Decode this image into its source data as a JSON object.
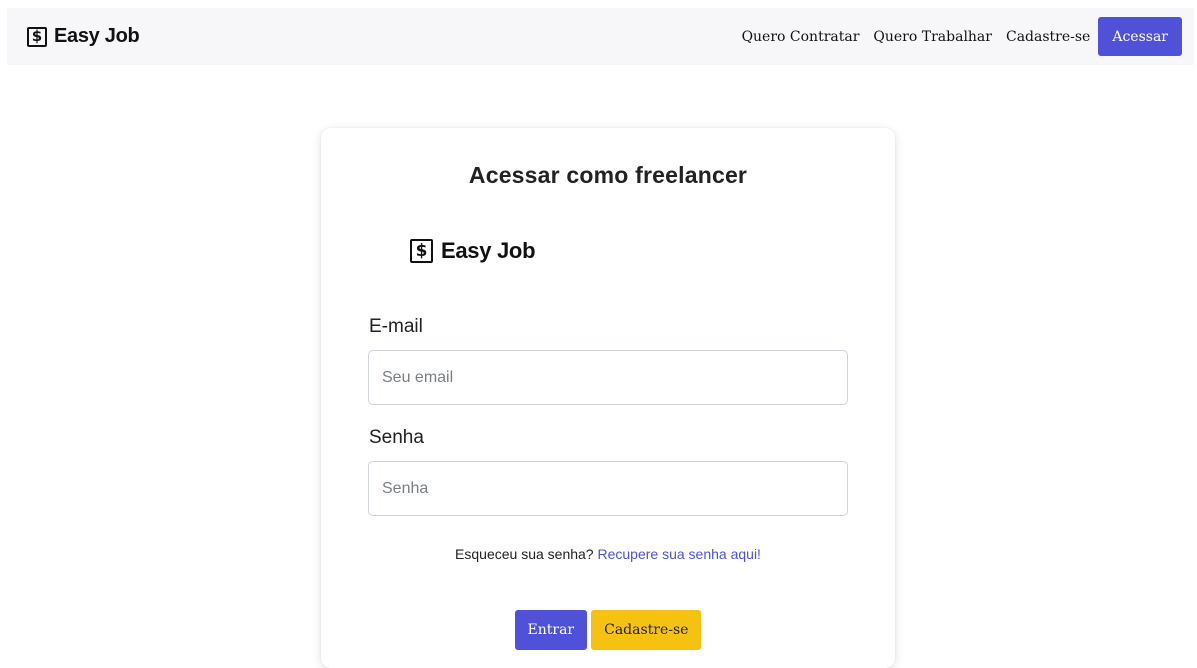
{
  "navbar": {
    "brand_symbol": "$",
    "brand_name": "Easy Job",
    "links": [
      "Quero Contratar",
      "Quero Trabalhar",
      "Cadastre-se"
    ],
    "access_button": "Acessar"
  },
  "card": {
    "title": "Acessar como freelancer",
    "brand_symbol": "$",
    "brand_name": "Easy Job",
    "email": {
      "label": "E-mail",
      "placeholder": "Seu email",
      "value": ""
    },
    "password": {
      "label": "Senha",
      "placeholder": "Senha",
      "value": ""
    },
    "forgot_text": "Esqueceu sua senha?",
    "forgot_link": "Recupere sua senha aqui!",
    "submit_button": "Entrar",
    "register_button": "Cadastre-se"
  },
  "colors": {
    "primary": "#4f52d9",
    "warning": "#f5c211",
    "navbar_bg": "#f7f7f9"
  }
}
